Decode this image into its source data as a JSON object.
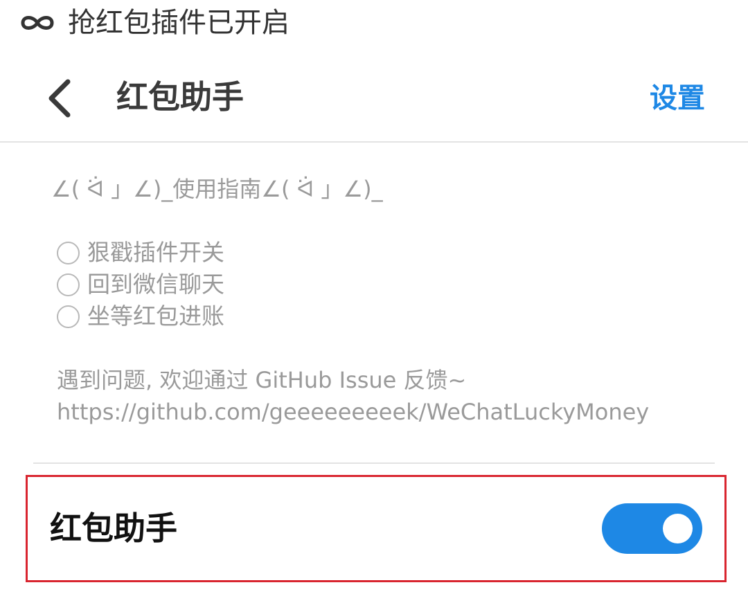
{
  "status_bar": {
    "icon": "infinity-icon",
    "text": "抢红包插件已开启"
  },
  "app_bar": {
    "back_icon": "chevron-left-icon",
    "title": "红包助手",
    "settings_label": "设置"
  },
  "guide": {
    "title": "∠( ᐛ 」∠)_使用指南∠( ᐛ 」∠)_",
    "steps": [
      {
        "label": "狠戳插件开关"
      },
      {
        "label": "回到微信聊天"
      },
      {
        "label": "坐等红包进账"
      }
    ],
    "feedback_line1": "遇到问题, 欢迎通过 GitHub Issue 反馈~",
    "feedback_line2": "https://github.com/geeeeeeeeek/WeChatLuckyMoney"
  },
  "toggle": {
    "label": "红包助手",
    "checked": true
  },
  "colors": {
    "accent": "#1e88e5",
    "highlight_frame": "#d9252f",
    "muted_text": "#9a9a9a"
  }
}
